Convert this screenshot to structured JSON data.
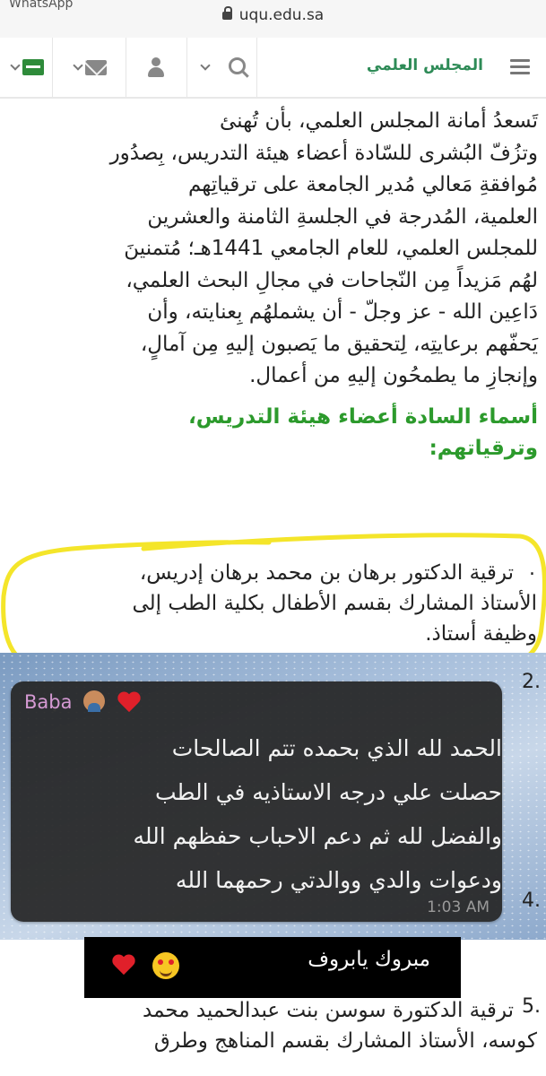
{
  "browser": {
    "app_name": "WhatsApp",
    "url": "uqu.edu.sa"
  },
  "navbar": {
    "brand": "المجلس العلمي",
    "icons": [
      "screen-icon",
      "mail-icon",
      "user-icon",
      "search-icon",
      "menu-icon"
    ],
    "accent_color": "#2e8b57"
  },
  "article": {
    "intro_line1": "تَسعدُ أمانة المجلس العلمي، بأن تُهنئ",
    "intro_line2": "وتزُفّ البُشرى للسّادة أعضاء هيئة التدريس، بِصدُور",
    "intro_line3": "مُوافقةِ مَعالي مُدير الجامعة على ترقياتِهم",
    "intro_line4": "العلمية، المُدرجة في الجلسةِ الثامنة والعشرين",
    "intro_line5": "للمجلس العلمي، للعام الجامعي 1441هـ؛ مُتمنينَ",
    "intro_line6": "لهُم مَزيداً مِن النّجاحات في مجالِ البحث العلمي،",
    "intro_line7": "دَاعِين الله - عز وجلّ - أن يشملهُم بِعنايته، وأن",
    "intro_line8": "يَحفّهم برعايتِه، لِتحقيق ما يَصبون إليهِ مِن آمالٍ،",
    "intro_line9": "وإنجازِ ما يطمحُون إليهِ من أعمال.",
    "heading_line1": "أسماء السادة أعضاء هيئة التدريس،",
    "heading_line2": "وترقياتهم:",
    "heading_color": "#2c9a2c"
  },
  "items": {
    "item1_num": ".",
    "item1_line1": "ترقية الدكتور برهان بن محمد برهان إدريس،",
    "item1_line2": "الأستاذ المشارك بقسم الأطفال بكلية الطب إلى",
    "item1_line3": "وظيفة أستاذ.",
    "item2_num": "2.",
    "item4_num": "4.",
    "item5_num": "5.",
    "item5_line1": "ترقية الدكتورة سوسن بنت عبدالحميد محمد",
    "item5_line2": "كوسه، الأستاذ المشارك بقسم المناهج وطرق"
  },
  "message": {
    "sender": "Baba",
    "line1": "الحمد لله الذي بحمده تتم الصالحات",
    "line2": "حصلت علي درجه الاستاذيه في الطب",
    "line3": "والفضل لله ثم دعم الاحباب حفظهم الله",
    "line4": "ودعوات والدي ووالدتي رحمهما الله",
    "time": "1:03 AM"
  },
  "caption": {
    "text": "مبروك يابروف"
  }
}
